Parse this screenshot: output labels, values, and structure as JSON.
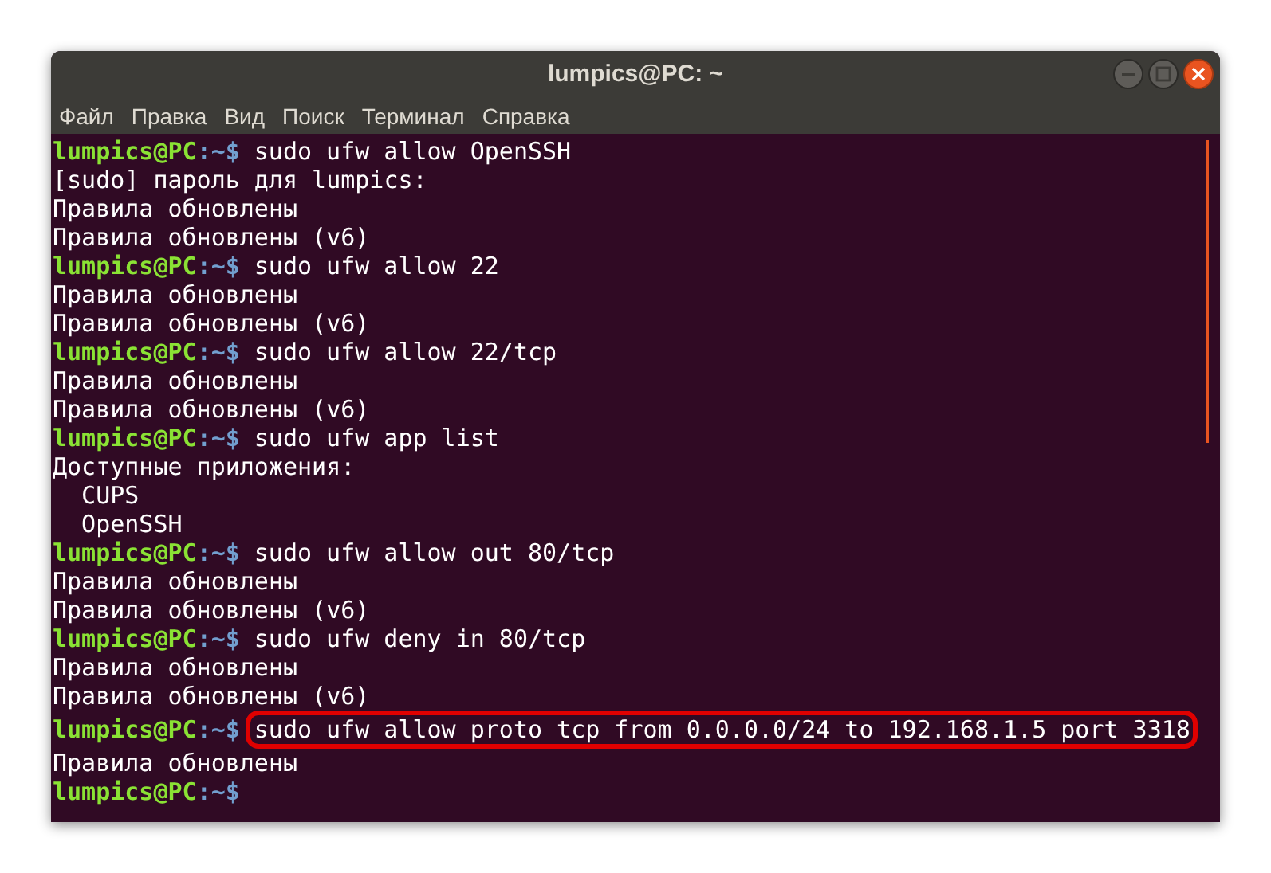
{
  "window": {
    "title": "lumpics@PC: ~"
  },
  "menu": [
    "Файл",
    "Правка",
    "Вид",
    "Поиск",
    "Терминал",
    "Справка"
  ],
  "terminal": {
    "lines": [
      {
        "kind": "prompt",
        "user": "lumpics@PC",
        "path": ":~$",
        "command": "sudo ufw allow OpenSSH",
        "highlighted": false
      },
      {
        "kind": "output",
        "text": "[sudo] пароль для lumpics:"
      },
      {
        "kind": "output",
        "text": "Правила обновлены"
      },
      {
        "kind": "output",
        "text": "Правила обновлены (v6)"
      },
      {
        "kind": "prompt",
        "user": "lumpics@PC",
        "path": ":~$",
        "command": "sudo ufw allow 22",
        "highlighted": false
      },
      {
        "kind": "output",
        "text": "Правила обновлены"
      },
      {
        "kind": "output",
        "text": "Правила обновлены (v6)"
      },
      {
        "kind": "prompt",
        "user": "lumpics@PC",
        "path": ":~$",
        "command": "sudo ufw allow 22/tcp",
        "highlighted": false
      },
      {
        "kind": "output",
        "text": "Правила обновлены"
      },
      {
        "kind": "output",
        "text": "Правила обновлены (v6)"
      },
      {
        "kind": "prompt",
        "user": "lumpics@PC",
        "path": ":~$",
        "command": "sudo ufw app list",
        "highlighted": false
      },
      {
        "kind": "output",
        "text": "Доступные приложения:"
      },
      {
        "kind": "output",
        "text": "  CUPS"
      },
      {
        "kind": "output",
        "text": "  OpenSSH"
      },
      {
        "kind": "prompt",
        "user": "lumpics@PC",
        "path": ":~$",
        "command": "sudo ufw allow out 80/tcp",
        "highlighted": false
      },
      {
        "kind": "output",
        "text": "Правила обновлены"
      },
      {
        "kind": "output",
        "text": "Правила обновлены (v6)"
      },
      {
        "kind": "prompt",
        "user": "lumpics@PC",
        "path": ":~$",
        "command": "sudo ufw deny in 80/tcp",
        "highlighted": false
      },
      {
        "kind": "output",
        "text": "Правила обновлены"
      },
      {
        "kind": "output",
        "text": "Правила обновлены (v6)"
      },
      {
        "kind": "prompt",
        "user": "lumpics@PC",
        "path": ":~$",
        "command": "sudo ufw allow proto tcp from 0.0.0.0/24 to 192.168.1.5 port 3318",
        "highlighted": true
      },
      {
        "kind": "output",
        "text": "Правила обновлены"
      },
      {
        "kind": "prompt",
        "user": "lumpics@PC",
        "path": ":~$"
      }
    ]
  }
}
